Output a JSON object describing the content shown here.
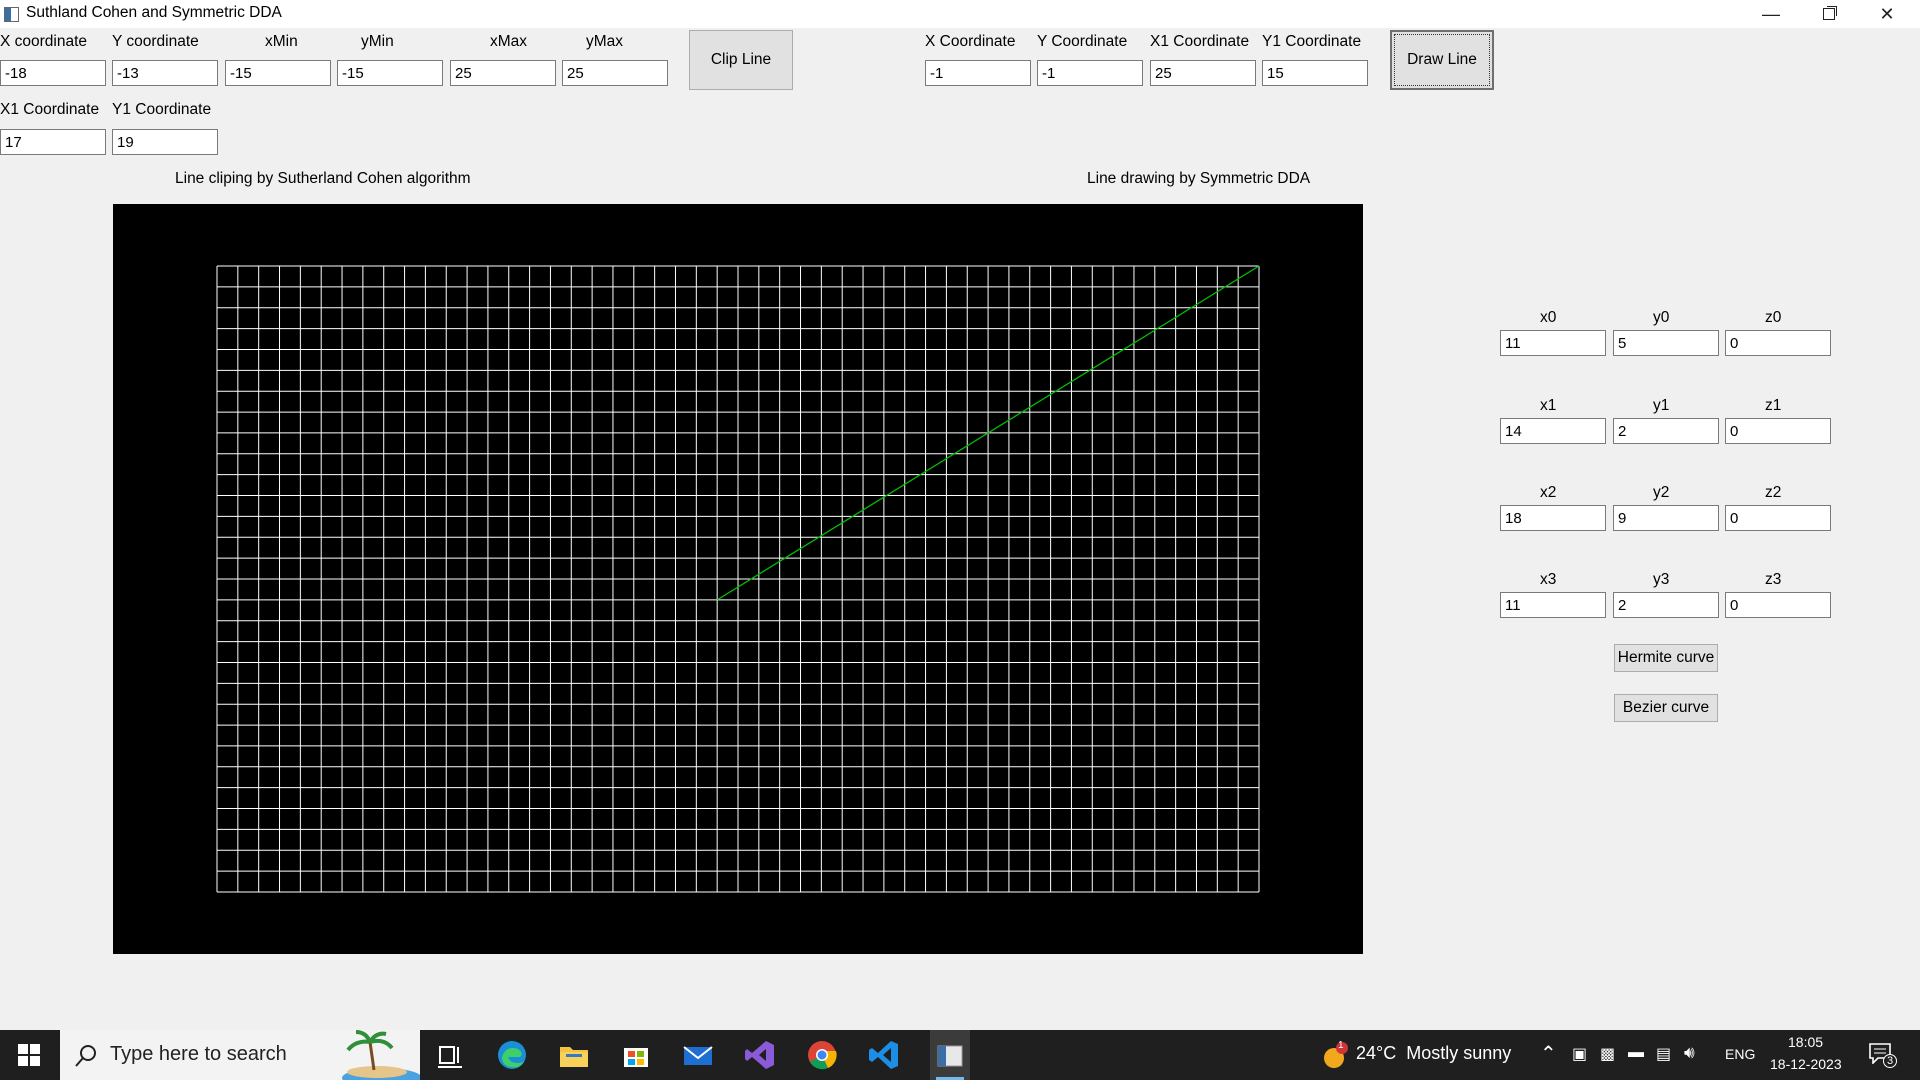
{
  "window": {
    "title": "Suthland Cohen and Symmetric DDA"
  },
  "clip": {
    "labels": {
      "x": "X coordinate",
      "y": "Y coordinate",
      "xmin": "xMin",
      "ymin": "yMin",
      "xmax": "xMax",
      "ymax": "yMax",
      "x1": "X1 Coordinate",
      "y1": "Y1 Coordinate"
    },
    "values": {
      "x": "-18",
      "y": "-13",
      "xmin": "-15",
      "ymin": "-15",
      "xmax": "25",
      "ymax": "25",
      "x1": "17",
      "y1": "19"
    },
    "button": "Clip Line",
    "caption": "Line cliping by Sutherland Cohen algorithm"
  },
  "dda": {
    "labels": {
      "x": "X Coordinate",
      "y": "Y Coordinate",
      "x1": "X1 Coordinate",
      "y1": "Y1 Coordinate"
    },
    "values": {
      "x": "-1",
      "y": "-1",
      "x1": "25",
      "y1": "15"
    },
    "button": "Draw Line",
    "caption": "Line drawing by Symmetric DDA"
  },
  "curve": {
    "labels": [
      "x0",
      "y0",
      "z0",
      "x1",
      "y1",
      "z1",
      "x2",
      "y2",
      "z2",
      "x3",
      "y3",
      "z3"
    ],
    "values": [
      "11",
      "5",
      "0",
      "14",
      "2",
      "0",
      "18",
      "9",
      "0",
      "11",
      "2",
      "0"
    ],
    "hermite_button": "Hermite curve",
    "bezier_button": "Bezier curve"
  },
  "grid": {
    "columns": 50,
    "rows": 30,
    "line_color": "#ffffff",
    "background": "#000000"
  },
  "drawn_line": {
    "color": "#00c000",
    "from": [
      -1,
      -1
    ],
    "to": [
      25,
      15
    ]
  },
  "taskbar": {
    "search_placeholder": "Type here to search",
    "weather": "24°C  Mostly sunny",
    "weather_badge": "1",
    "language": "ENG",
    "time": "18:05",
    "date": "18-12-2023",
    "notifications": "3"
  }
}
